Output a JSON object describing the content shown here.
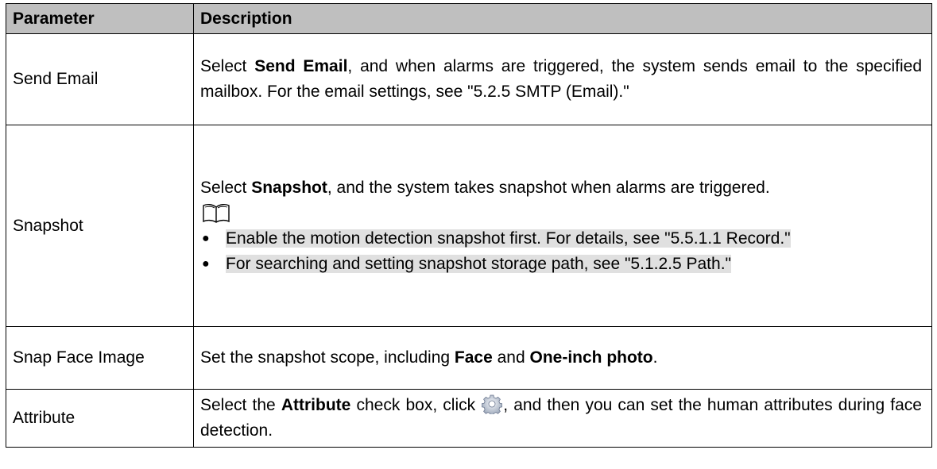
{
  "header": {
    "parameter": "Parameter",
    "description": "Description"
  },
  "rows": {
    "send_email": {
      "param": "Send Email",
      "pre": "Select ",
      "bold": "Send Email",
      "post": ", and when alarms are triggered, the system sends email to the specified mailbox. For the email settings, see \"5.2.5 SMTP (Email).\""
    },
    "snapshot": {
      "param": "Snapshot",
      "pre": "Select ",
      "bold": "Snapshot",
      "post": ", and the system takes snapshot when alarms are triggered.",
      "note_icon": "book-note-icon",
      "bullets": [
        "Enable the motion detection snapshot first. For details, see \"5.5.1.1 Record.\"",
        "For searching and setting snapshot storage path, see \"5.1.2.5 Path.\""
      ],
      "bullet_glyph": "●"
    },
    "snap_face": {
      "param": "Snap Face Image",
      "pre": "Set the snapshot scope, including ",
      "bold1": "Face",
      "mid": " and ",
      "bold2": "One-inch photo",
      "post": "."
    },
    "attribute": {
      "param": "Attribute",
      "pre": "Select the ",
      "bold": "Attribute",
      "mid": " check box, click ",
      "icon": "gear-icon",
      "post": ", and then you can set the human attributes during face detection."
    }
  },
  "colors": {
    "header_bg": "#bfbfbf",
    "highlight_bg": "#e0e0e0",
    "border": "#000000"
  }
}
